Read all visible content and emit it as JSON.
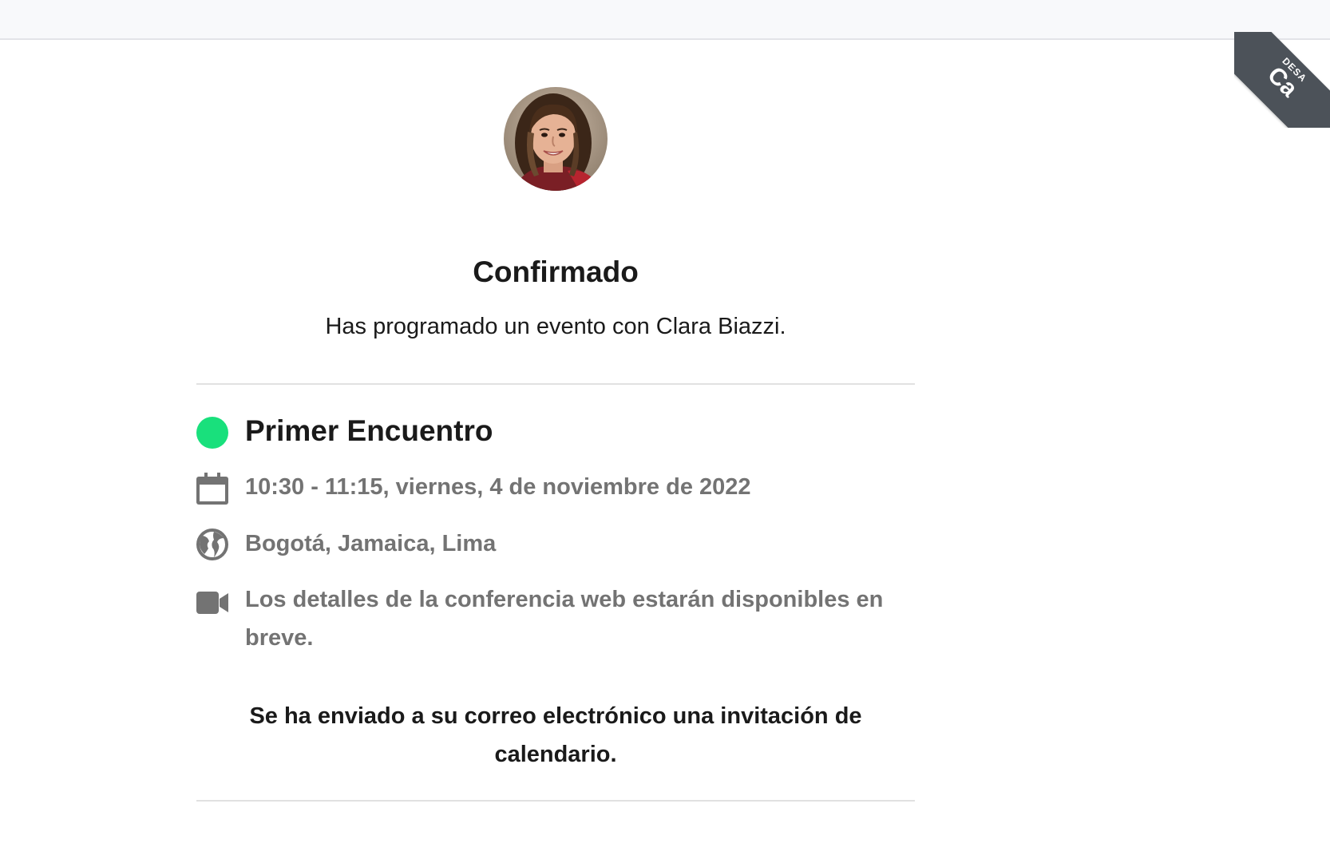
{
  "ribbon": {
    "small_text": "DESA",
    "big_text": "Ca"
  },
  "header": {
    "title": "Confirmado",
    "subtitle": "Has programado un evento con Clara Biazzi."
  },
  "event": {
    "name": "Primer Encuentro",
    "color": "#19e07c",
    "datetime": "10:30 - 11:15, viernes, 4 de noviembre de 2022",
    "timezone": "Bogotá, Jamaica, Lima",
    "conference": "Los detalles de la conferencia web estarán disponibles en breve."
  },
  "footer": {
    "invite_message": "Se ha enviado a su correo electrónico una invitación de calendario."
  },
  "icons": {
    "calendar": "calendar-icon",
    "globe": "globe-icon",
    "video": "video-camera-icon"
  }
}
